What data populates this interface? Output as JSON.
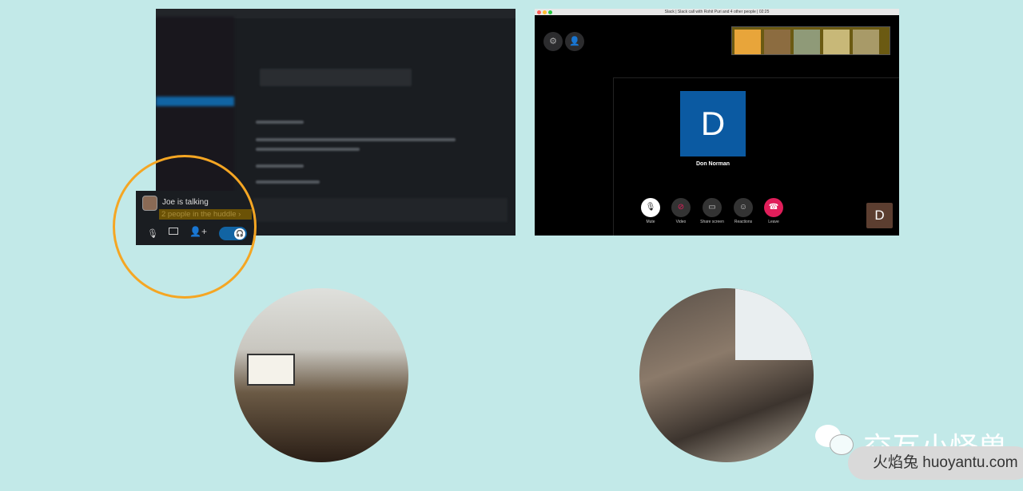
{
  "huddle": {
    "status": "Joe is talking",
    "people": "2 people in the huddle",
    "accent": "#f5a623"
  },
  "call": {
    "window_title": "Slack | Slack call with Rohit Puri and 4 other people | 02:25",
    "participant_initial": "D",
    "participant_name": "Don Norman",
    "self_initial": "D",
    "controls": [
      {
        "label": "Mute",
        "icon": "microphone-icon"
      },
      {
        "label": "Video",
        "icon": "video-off-icon"
      },
      {
        "label": "Share screen",
        "icon": "share-screen-icon"
      },
      {
        "label": "Reactions",
        "icon": "smiley-icon"
      },
      {
        "label": "Leave",
        "icon": "hang-up-icon"
      }
    ]
  },
  "watermark": {
    "brand": "交互小怪兽",
    "site": "火焰兔 huoyantu.com"
  }
}
